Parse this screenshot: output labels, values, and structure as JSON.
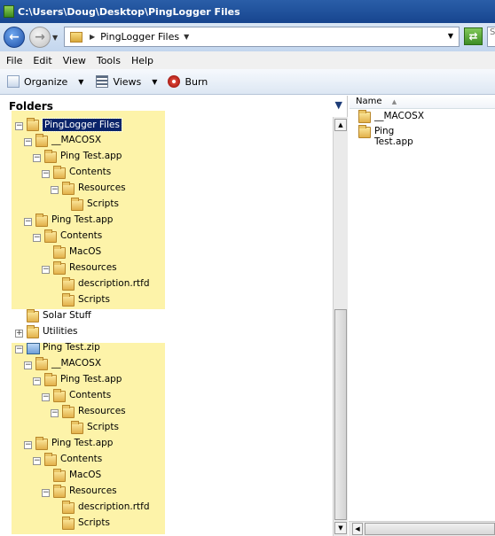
{
  "window": {
    "title": "C:\\Users\\Doug\\Desktop\\PingLogger Files"
  },
  "nav": {
    "back_glyph": "←",
    "forward_glyph": "→",
    "address": "PingLogger Files",
    "refresh_glyph": "⇄",
    "search_placeholder": "S"
  },
  "menu": [
    "File",
    "Edit",
    "View",
    "Tools",
    "Help"
  ],
  "toolbar": {
    "organize": "Organize",
    "views": "Views",
    "burn": "Burn"
  },
  "tree": {
    "header": "Folders",
    "nodes": [
      {
        "label": "PingLogger Files",
        "selected": true,
        "icon": "folder-icon"
      },
      {
        "label": "__MACOSX",
        "icon": "folder-icon"
      },
      {
        "label": "Ping Test.app",
        "icon": "folder-icon"
      },
      {
        "label": "Contents",
        "icon": "folder-icon"
      },
      {
        "label": "Resources",
        "icon": "folder-icon"
      },
      {
        "label": "Scripts",
        "icon": "folder-icon"
      },
      {
        "label": "Ping Test.app",
        "icon": "folder-icon"
      },
      {
        "label": "Contents",
        "icon": "folder-icon"
      },
      {
        "label": "MacOS",
        "icon": "folder-icon"
      },
      {
        "label": "Resources",
        "icon": "folder-icon"
      },
      {
        "label": "description.rtfd",
        "icon": "folder-icon"
      },
      {
        "label": "Scripts",
        "icon": "folder-icon"
      },
      {
        "label": "Solar Stuff",
        "icon": "folder-icon"
      },
      {
        "label": "Utilities",
        "icon": "folder-icon"
      },
      {
        "label": "Ping Test.zip",
        "icon": "zip-folder-icon"
      },
      {
        "label": "__MACOSX",
        "icon": "folder-icon"
      },
      {
        "label": "Ping Test.app",
        "icon": "folder-icon"
      },
      {
        "label": "Contents",
        "icon": "folder-icon"
      },
      {
        "label": "Resources",
        "icon": "folder-icon"
      },
      {
        "label": "Scripts",
        "icon": "folder-icon"
      },
      {
        "label": "Ping Test.app",
        "icon": "folder-icon"
      },
      {
        "label": "Contents",
        "icon": "folder-icon"
      },
      {
        "label": "MacOS",
        "icon": "folder-icon"
      },
      {
        "label": "Resources",
        "icon": "folder-icon"
      },
      {
        "label": "description.rtfd",
        "icon": "folder-icon"
      },
      {
        "label": "Scripts",
        "icon": "folder-icon"
      }
    ]
  },
  "list": {
    "column_name": "Name",
    "items": [
      "__MACOSX",
      "Ping Test.app"
    ]
  },
  "colors": {
    "highlight": "#fdf3a9",
    "selection": "#0a246a",
    "titlebar": "#17458f"
  }
}
